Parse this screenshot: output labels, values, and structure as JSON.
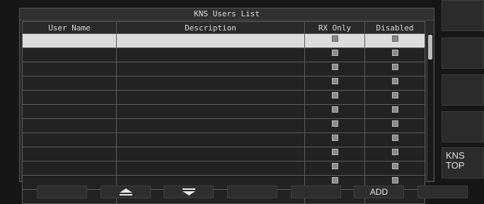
{
  "panel": {
    "title": "KNS Users List",
    "columns": {
      "user_name": "User Name",
      "description": "Description",
      "rx_only": "RX Only",
      "disabled": "Disabled"
    },
    "row_count": 12,
    "selected_row": 0
  },
  "side_buttons": [
    "",
    "",
    "",
    "",
    "KNS\nTOP"
  ],
  "side_kns_top": {
    "line1": "KNS",
    "line2": "TOP"
  },
  "bottom_buttons": {
    "b1": "",
    "b2_icon": "triangle-up-icon",
    "b3_icon": "triangle-down-icon",
    "b4": "",
    "b5": "",
    "add_label": "ADD",
    "b7": ""
  }
}
